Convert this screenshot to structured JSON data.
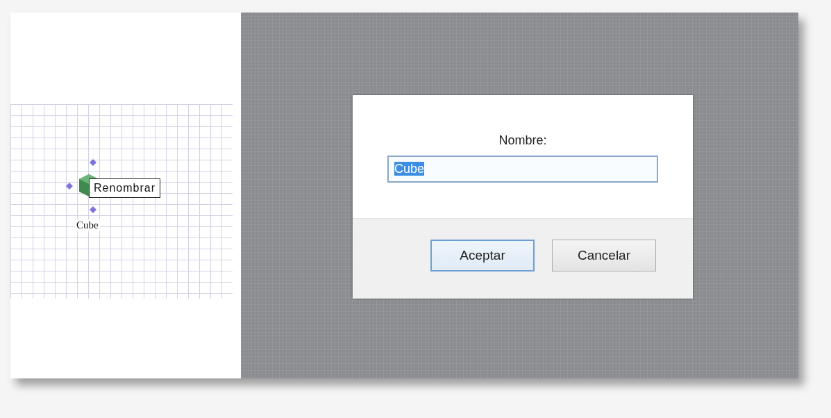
{
  "canvas": {
    "node": {
      "label": "Cube",
      "selected": true
    },
    "tooltip": "Renombrar"
  },
  "dialog": {
    "label": "Nombre:",
    "field": {
      "value": "Cube",
      "text_selected": true
    },
    "buttons": [
      {
        "label": "Aceptar",
        "focused": true
      },
      {
        "label": "Cancelar",
        "focused": false
      }
    ]
  }
}
